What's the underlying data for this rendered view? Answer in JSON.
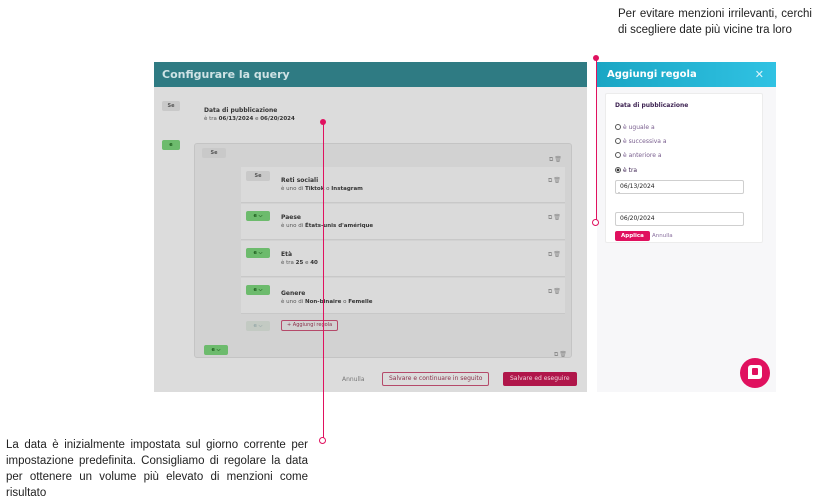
{
  "annotations": {
    "top": "Per evitare menzioni irrilevanti, cerchi di scegliere date più vicine tra loro",
    "bottom": "La data è inizialmente impostata sul giorno corrente per impostazione predefinita. Consigliamo di regolare la data per ottenere un volume più elevato di menzioni come risultato"
  },
  "modal": {
    "title": "Configurare la query",
    "top_chip": "Se",
    "date_rule": {
      "title": "Data di pubblicazione",
      "prefix": "è tra",
      "from": "06/13/2024",
      "conj": "e",
      "to": "06/20/2024"
    },
    "outer_chip": "e",
    "group_chip": "Se",
    "rules": [
      {
        "chip": "Se",
        "title": "Reti sociali",
        "prefix": "è uno di",
        "v1": "Tiktok",
        "conj": "o",
        "v2": "Instagram"
      },
      {
        "chip": "e ⌵",
        "title": "Paese",
        "prefix": "è uno di",
        "v1": "États-unis d'amérique",
        "conj": "",
        "v2": ""
      },
      {
        "chip": "e ⌵",
        "title": "Età",
        "prefix": "è tra",
        "v1": "25",
        "conj": "e",
        "v2": "40"
      },
      {
        "chip": "e ⌵",
        "title": "Genere",
        "prefix": "è uno di",
        "v1": "Non-binaire",
        "conj": "o",
        "v2": "Femelle"
      }
    ],
    "faint_chip": "e ⌵",
    "add_rule_label": "+ Aggiungi regola",
    "bottom_chip": "e ⌵",
    "icons": "⧉🗑",
    "footer": {
      "cancel": "Annulla",
      "save_continue": "Salvare e continuare in seguito",
      "save_run": "Salvare ed eseguire"
    }
  },
  "panel": {
    "title": "Aggiungi regola",
    "close": "✕",
    "card_title": "Data di pubblicazione",
    "options": [
      "è uguale a",
      "è successiva a",
      "è anteriore a",
      "è tra"
    ],
    "selected_option": "è tra",
    "date_from": "06/13/2024",
    "separator": "-",
    "date_to": "06/20/2024",
    "apply": "Applica",
    "cancel": "Annulla"
  },
  "colors": {
    "accent": "#e0115f",
    "header_teal": "#2f7b83",
    "panel_header": "#30c2e3"
  }
}
